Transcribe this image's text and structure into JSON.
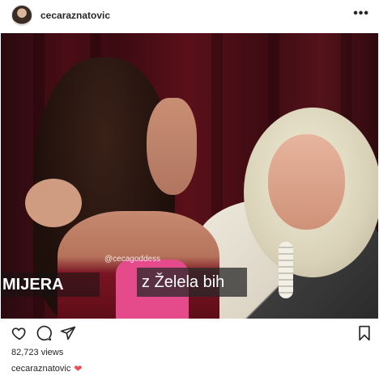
{
  "header": {
    "username": "cecaraznatovic",
    "more_label": "•••"
  },
  "media": {
    "watermark": "@cecagoddess",
    "lower_left_text": "MIJERA",
    "caption_text": "Želela bih",
    "caption_prefix": "z"
  },
  "actions": {
    "icons": [
      "heart-icon",
      "comment-icon",
      "share-icon",
      "bookmark-icon"
    ]
  },
  "stats": {
    "views": "82,723 views"
  },
  "caption": {
    "username": "cecaraznatovic",
    "emoji": "❤"
  },
  "colors": {
    "heart_red": "#ed4956",
    "text": "#262626"
  }
}
